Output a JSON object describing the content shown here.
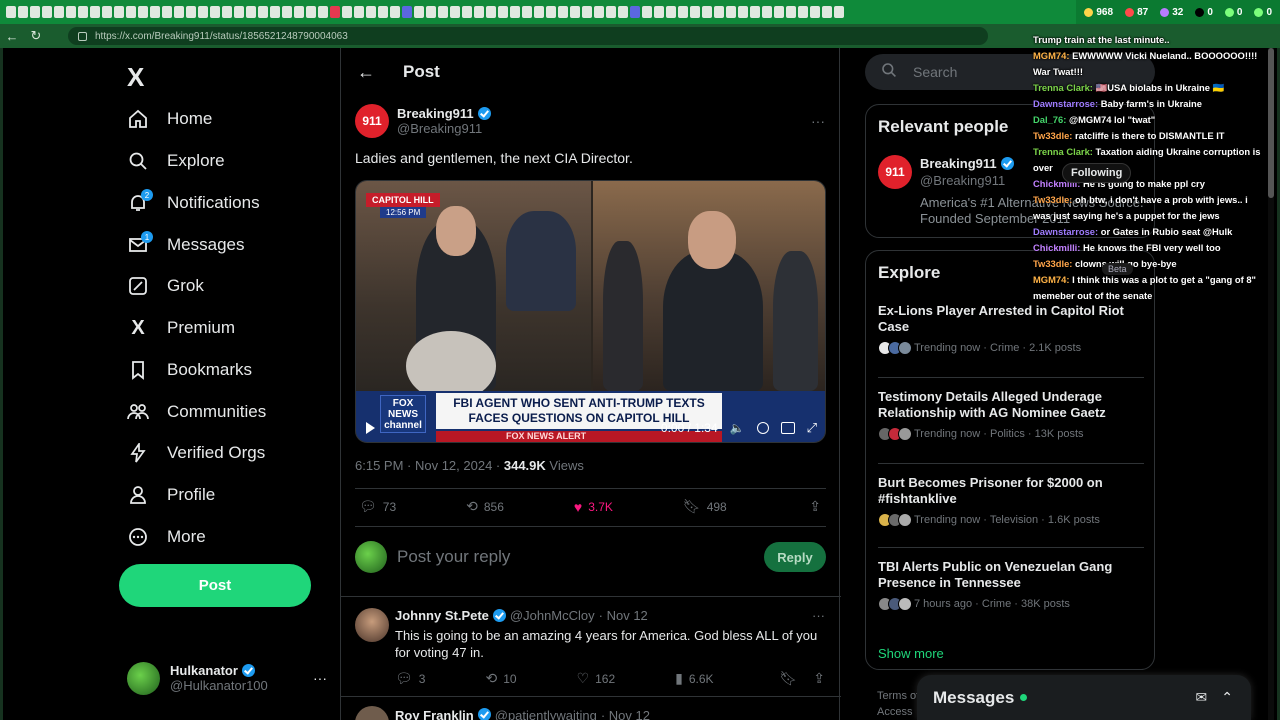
{
  "browser": {
    "url": "https://x.com/Breaking911/status/1856521248790004063",
    "extensions": [
      {
        "icon": "extension-icon-1",
        "count": "968"
      },
      {
        "icon": "extension-icon-2",
        "count": "87"
      },
      {
        "icon": "extension-icon-3",
        "count": "32"
      },
      {
        "icon": "extension-icon-4",
        "count": "0"
      },
      {
        "icon": "extension-icon-5",
        "count": "0"
      },
      {
        "icon": "extension-icon-6",
        "count": "0"
      }
    ]
  },
  "leftnav": {
    "logo": "X",
    "items": [
      {
        "label": "Home",
        "icon": "home-icon"
      },
      {
        "label": "Explore",
        "icon": "search-icon"
      },
      {
        "label": "Notifications",
        "icon": "bell-icon",
        "badge": "2"
      },
      {
        "label": "Messages",
        "icon": "mail-icon",
        "badge": "1"
      },
      {
        "label": "Grok",
        "icon": "grok-icon"
      },
      {
        "label": "Premium",
        "icon": "x-premium-icon"
      },
      {
        "label": "Bookmarks",
        "icon": "bookmark-icon"
      },
      {
        "label": "Communities",
        "icon": "communities-icon"
      },
      {
        "label": "Verified Orgs",
        "icon": "lightning-icon"
      },
      {
        "label": "Profile",
        "icon": "person-icon"
      },
      {
        "label": "More",
        "icon": "more-circle-icon"
      }
    ],
    "post_button": "Post",
    "account": {
      "name": "Hulkanator",
      "handle": "@Hulkanator100"
    }
  },
  "post": {
    "header": "Post",
    "author": {
      "name": "Breaking911",
      "handle": "@Breaking911",
      "avatar": "911"
    },
    "text": "Ladies and gentlemen, the next CIA Director.",
    "video": {
      "channel_tag": "CAPITOL HILL",
      "clock": "12:56 PM",
      "network": "FOX NEWS channel",
      "chyron": "FBI AGENT WHO SENT ANTI-TRUMP TEXTS FACES QUESTIONS ON CAPITOL HILL",
      "alert": "FOX NEWS ALERT",
      "time": "0:00 / 1:34"
    },
    "timestamp": "6:15 PM · Nov 12, 2024 · ",
    "views": "344.9K",
    "views_label": " Views",
    "stats": {
      "replies": "73",
      "reposts": "856",
      "likes": "3.7K",
      "bookmarks": "498"
    },
    "reply_placeholder": "Post your reply",
    "reply_button": "Reply"
  },
  "replies": [
    {
      "name": "Johnny St.Pete",
      "handle": "@JohnMcCloy",
      "date": "· Nov 12",
      "text": "This is going to be an amazing 4 years for America. God bless ALL of you for voting 47 in.",
      "stats": {
        "replies": "3",
        "reposts": "10",
        "likes": "162",
        "views": "6.6K"
      }
    },
    {
      "name": "Roy Franklin",
      "handle": "@patientlywaiting",
      "date": "· Nov 12"
    }
  ],
  "right": {
    "search_placeholder": "Search",
    "relevant_title": "Relevant people",
    "relevant": {
      "name": "Breaking911",
      "handle": "@Breaking911",
      "bio": "America's #1 Alternative News Source. Founded September 2011"
    },
    "explore_title": "Explore",
    "trends": [
      {
        "title": "Ex-Lions Player Arrested in Capitol Riot Case",
        "meta": "Trending now · Crime · 2.1K posts"
      },
      {
        "title": "Testimony Details Alleged Underage Relationship with AG Nominee Gaetz",
        "meta": "Trending now · Politics · 13K posts"
      },
      {
        "title": "Burt Becomes Prisoner for $2000 on #fishtanklive",
        "meta": "Trending now · Television · 1.6K posts"
      },
      {
        "title": "TBI Alerts Public on Venezuelan Gang Presence in Tennessee",
        "meta": "7 hours ago · Crime · 38K posts"
      }
    ],
    "show_more": "Show more",
    "footer": [
      "Terms of",
      "Access"
    ],
    "messages_dock": "Messages"
  },
  "overlay": {
    "following_tip": "Following",
    "beta_tip": "Beta",
    "chat": [
      {
        "user": "",
        "text": "Trump train at the last minute.."
      },
      {
        "user": "MGM74:",
        "text": " EWWWWW Vicki Nueland.. BOOOOOO!!!! War Twat!!!"
      },
      {
        "user": "Trenna Clark:",
        "text": " 🇺🇸USA biolabs in Ukraine 🇺🇦"
      },
      {
        "user": "Dawnstarrose:",
        "text": " Baby farm's in Ukraine"
      },
      {
        "user": "Dal_76:",
        "text": " @MGM74 lol \"twat\""
      },
      {
        "user": "Tw33dle:",
        "text": " ratcliffe is there to DISMANTLE IT"
      },
      {
        "user": "Trenna Clark:",
        "text": " Taxation aiding Ukraine corruption is over"
      },
      {
        "user": "Chickmilli:",
        "text": " He is going to make ppl cry"
      },
      {
        "user": "Tw33dle:",
        "text": " oh btw, i don't have a prob with jews.. i was just saying he's a puppet for the jews"
      },
      {
        "user": "Dawnstarrose:",
        "text": " or Gates in Rubio seat @Hulk"
      },
      {
        "user": "Chickmilli:",
        "text": " He knows the FBI very well too"
      },
      {
        "user": "Tw33dle:",
        "text": " clowns will go bye-bye"
      },
      {
        "user": "MGM74:",
        "text": " I think this was a plot to get a \"gang of 8\" memeber out of the senate"
      }
    ]
  }
}
